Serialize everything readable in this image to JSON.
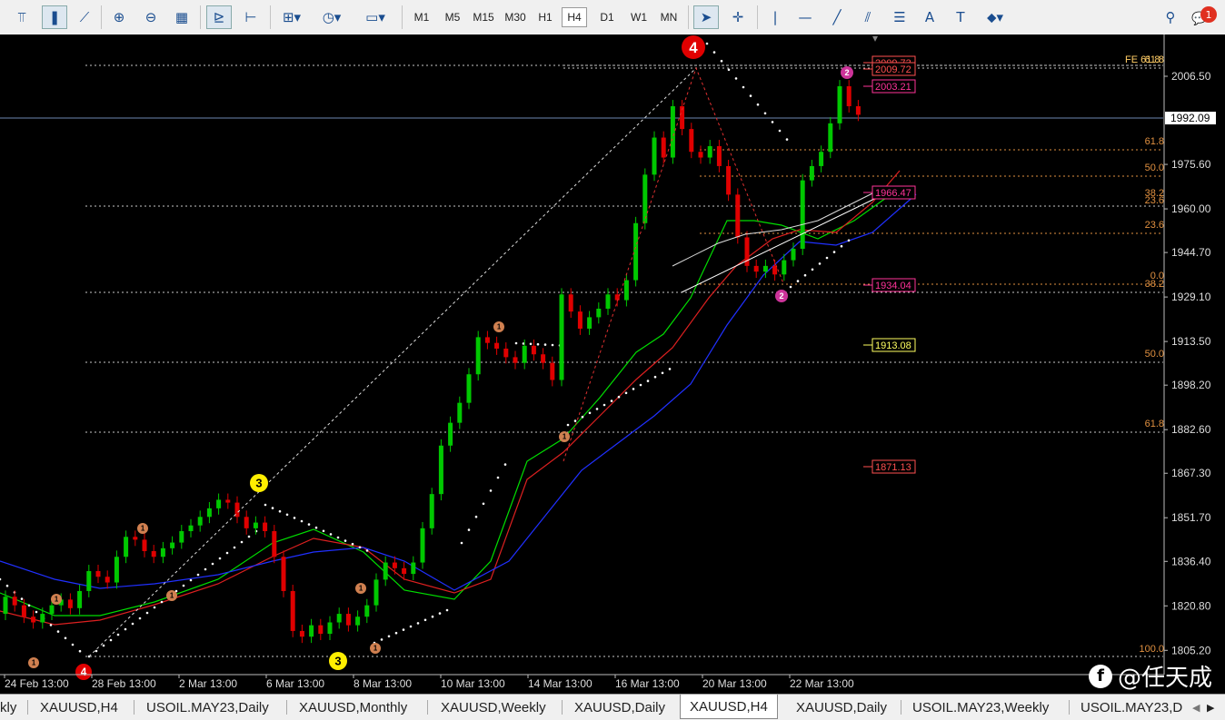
{
  "toolbar": {
    "timeframes": [
      "M1",
      "M5",
      "M15",
      "M30",
      "H1",
      "H4",
      "D1",
      "W1",
      "MN"
    ],
    "active_timeframe": "H4",
    "notification_count": "1"
  },
  "chart": {
    "symbol": "XAUUSD",
    "timeframe": "H4",
    "current_price": "1992.09",
    "price_axis": [
      "2006.50",
      "1975.60",
      "1960.00",
      "1944.70",
      "1929.10",
      "1913.50",
      "1898.20",
      "1882.60",
      "1867.30",
      "1851.70",
      "1836.40",
      "1820.80",
      "1805.20"
    ],
    "time_axis": [
      "24 Feb 13:00",
      "28 Feb 13:00",
      "2 Mar 13:00",
      "6 Mar 13:00",
      "8 Mar 13:00",
      "10 Mar 13:00",
      "14 Mar 13:00",
      "16 Mar 13:00",
      "20 Mar 13:00",
      "22 Mar 13:00"
    ],
    "fib_right": [
      "61.8",
      "50.0",
      "38.2",
      "23.6",
      "23.6",
      "0.0",
      "38.2",
      "50.0",
      "61.8",
      "100.0"
    ],
    "fib_top": [
      "FE 61.8",
      "61.8"
    ],
    "price_labels": [
      {
        "text": "2009.73",
        "color": "#ff5050"
      },
      {
        "text": "2009.72",
        "color": "#ff5050"
      },
      {
        "text": "2003.21",
        "color": "#ff3399"
      },
      {
        "text": "1966.47",
        "color": "#ff3399"
      },
      {
        "text": "1934.04",
        "color": "#ff3399"
      },
      {
        "text": "1913.08",
        "color": "#ffff60"
      },
      {
        "text": "1871.13",
        "color": "#ff5050"
      }
    ],
    "wave_labels": [
      "4",
      "4",
      "3",
      "3",
      "2",
      "2",
      "1",
      "1",
      "1",
      "1",
      "1",
      "1",
      "1",
      "1"
    ],
    "colors": {
      "bull": "#00c800",
      "bear": "#e00000",
      "ma_fast": "#00dd00",
      "ma_mid": "#dd2020",
      "ma_slow": "#2030ff",
      "grid": "#c8c8c8",
      "fib": "#e09040"
    }
  },
  "watermark": {
    "text": "@任天成",
    "logo": "f"
  },
  "tabs": {
    "items": [
      "kly",
      "XAUUSD,H4",
      "USOIL.MAY23,Daily",
      "XAUUSD,Monthly",
      "XAUUSD,Weekly",
      "XAUUSD,Daily",
      "XAUUSD,H4",
      "XAUUSD,Daily",
      "USOIL.MAY23,Weekly",
      "USOIL.MAY23,D"
    ],
    "active_index": 6
  }
}
